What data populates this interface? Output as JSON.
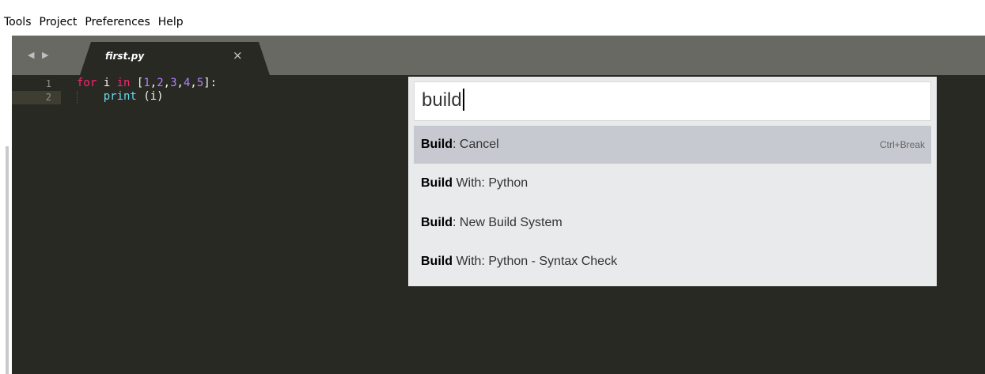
{
  "menu": [
    "Tools",
    "Project",
    "Preferences",
    "Help"
  ],
  "tab": {
    "nav": "◀ ▶",
    "title": "first.py",
    "close": "×"
  },
  "editor": {
    "line_numbers": [
      "1",
      "2"
    ],
    "code": [
      [
        {
          "t": "for",
          "c": "kw"
        },
        {
          "t": " i ",
          "c": ""
        },
        {
          "t": "in",
          "c": "kw"
        },
        {
          "t": " [",
          "c": ""
        },
        {
          "t": "1",
          "c": "num"
        },
        {
          "t": ",",
          "c": ""
        },
        {
          "t": "2",
          "c": "num"
        },
        {
          "t": ",",
          "c": ""
        },
        {
          "t": "3",
          "c": "num"
        },
        {
          "t": ",",
          "c": ""
        },
        {
          "t": "4",
          "c": "num"
        },
        {
          "t": ",",
          "c": ""
        },
        {
          "t": "5",
          "c": "num"
        },
        {
          "t": "]:",
          "c": ""
        }
      ],
      [
        {
          "t": "    ",
          "c": ""
        },
        {
          "t": "print",
          "c": "fn"
        },
        {
          "t": " (i)",
          "c": ""
        }
      ]
    ]
  },
  "palette": {
    "query": "build",
    "results": [
      {
        "bold": "Build",
        "rest": ": Cancel",
        "shortcut": "Ctrl+Break",
        "selected": true
      },
      {
        "bold": "Build",
        "rest": " With: Python",
        "shortcut": "",
        "selected": false
      },
      {
        "bold": "Build",
        "rest": ": New Build System",
        "shortcut": "",
        "selected": false
      },
      {
        "bold": "Build",
        "rest": " With: Python - Syntax Check",
        "shortcut": "",
        "selected": false
      }
    ]
  }
}
